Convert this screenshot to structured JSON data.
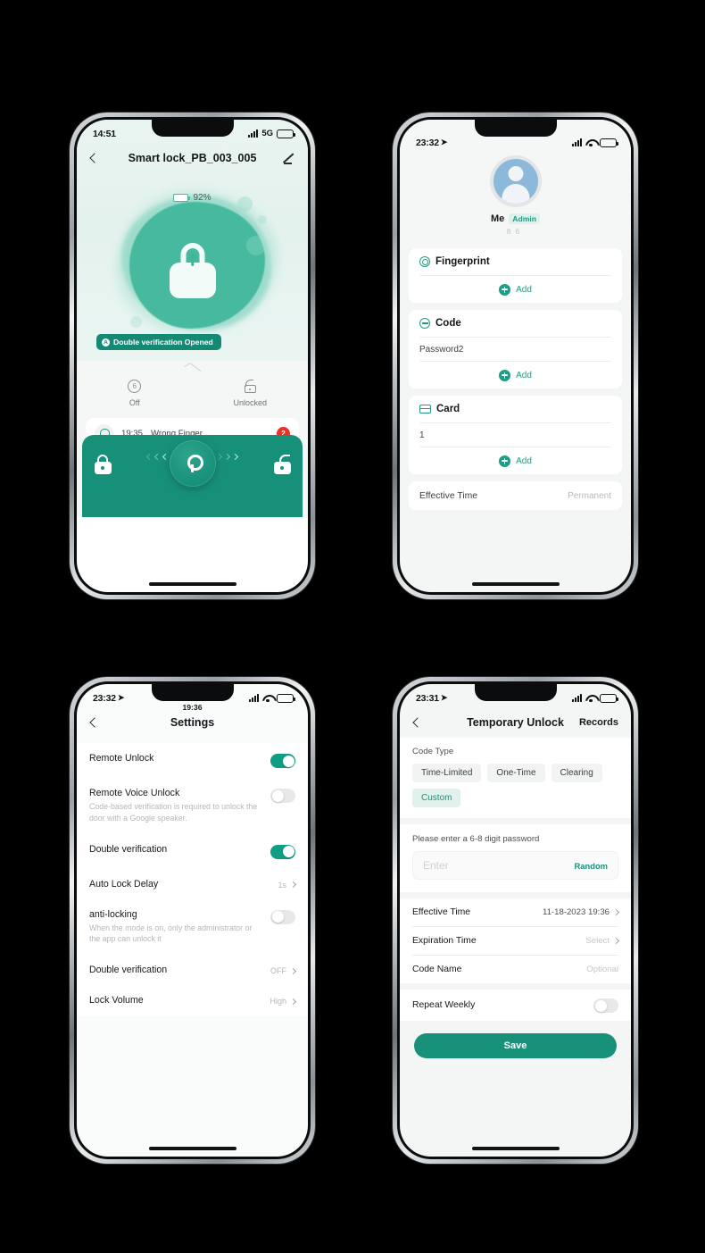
{
  "phones": {
    "lock_home": {
      "status": {
        "time": "14:51",
        "network": "5G",
        "battery_pct": 35
      },
      "nav": {
        "title": "Smart lock_PB_003_005",
        "back_icon": "chevron-left-icon",
        "edit_icon": "pencil-icon"
      },
      "battery": {
        "label": "92%"
      },
      "lock_state_icon": "padlock-closed-icon",
      "badge": {
        "text": "Double verification Opened",
        "icon_char": "A"
      },
      "quick": [
        {
          "label": "Off",
          "icon": "bell-off-icon"
        },
        {
          "label": "Unlocked",
          "icon": "unlock-icon"
        }
      ],
      "alert": {
        "time": "19:35",
        "text": "Wrong Finger",
        "count": "2",
        "icon": "bell-icon"
      },
      "controls": {
        "lock_icon": "lock-closed-icon",
        "unlock_icon": "lock-open-icon",
        "knob_icon": "key-icon"
      }
    },
    "member": {
      "status": {
        "time": "23:32",
        "battery_pct": 35
      },
      "profile": {
        "name": "Me",
        "role": "Admin",
        "sub": "86",
        "avatar_icon": "user-avatar"
      },
      "sections": [
        {
          "title": "Fingerprint",
          "icon": "fingerprint-icon",
          "entries": [],
          "add_label": "Add"
        },
        {
          "title": "Code",
          "icon": "code-icon",
          "entries": [
            "Password2"
          ],
          "add_label": "Add"
        },
        {
          "title": "Card",
          "icon": "card-icon",
          "entries": [
            "1"
          ],
          "add_label": "Add"
        }
      ],
      "effective_time": {
        "label": "Effective Time",
        "value": "Permanent"
      }
    },
    "settings": {
      "status": {
        "time": "23:32",
        "battery_pct": 35
      },
      "sub_time": "19:36",
      "nav": {
        "title": "Settings",
        "back_icon": "chevron-left-icon"
      },
      "items": [
        {
          "title": "Remote Unlock",
          "desc": "",
          "type": "toggle",
          "state": "on"
        },
        {
          "title": "Remote Voice Unlock",
          "desc": "Code-based verification is required to unlock the door with a Google speaker.",
          "type": "toggle",
          "state": "off"
        },
        {
          "title": "Double verification",
          "desc": "",
          "type": "toggle",
          "state": "on"
        },
        {
          "title": "Auto Lock Delay",
          "desc": "",
          "type": "value",
          "value": "1s"
        },
        {
          "title": "anti-locking",
          "desc": "When the mode is on, only the administrator or the app can unlock it",
          "type": "toggle",
          "state": "off"
        },
        {
          "title": "Double verification",
          "desc": "",
          "type": "value",
          "value": "OFF"
        },
        {
          "title": "Lock Volume",
          "desc": "",
          "type": "value",
          "value": "High"
        }
      ]
    },
    "temp_unlock": {
      "status": {
        "time": "23:31",
        "battery_pct": 35
      },
      "nav": {
        "title": "Temporary Unlock",
        "back_icon": "chevron-left-icon",
        "right_label": "Records"
      },
      "code_type": {
        "label": "Code Type",
        "options": [
          "Time-Limited",
          "One-Time",
          "Clearing",
          "Custom"
        ],
        "selected": "Custom"
      },
      "password": {
        "hint": "Please enter a 6-8 digit password",
        "placeholder": "Enter",
        "value": "",
        "random_label": "Random"
      },
      "rows": [
        {
          "label": "Effective Time",
          "value": "11-18-2023 19:36",
          "muted": false,
          "chevron": true
        },
        {
          "label": "Expiration Time",
          "value": "Select",
          "muted": true,
          "chevron": true
        },
        {
          "label": "Code Name",
          "value": "Optional",
          "muted": true,
          "chevron": false
        }
      ],
      "repeat_weekly": {
        "label": "Repeat Weekly",
        "state": "off"
      },
      "save_label": "Save"
    }
  },
  "colors": {
    "teal": "#18917b",
    "teal_light": "#3fb79c",
    "accent_text": "#19937c",
    "danger": "#ee3124"
  }
}
